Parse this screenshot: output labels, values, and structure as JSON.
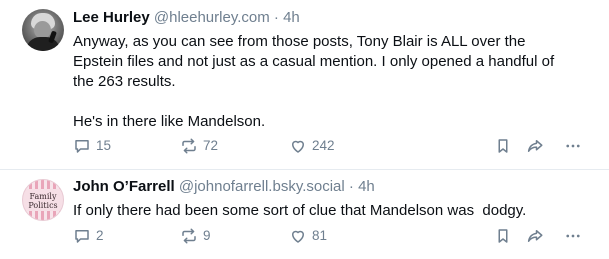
{
  "posts": [
    {
      "author": "Lee Hurley",
      "handle": "@hleehurley.com",
      "separator": "·",
      "time": "4h",
      "text_lines": [
        "Anyway, as you can see from those posts, Tony Blair is ALL over the",
        "Epstein files and not just as a casual mention. I only opened a handful of",
        "the 263 results.",
        "He's in there like Mandelson."
      ],
      "replies": "15",
      "reposts": "72",
      "likes": "242",
      "icons": [
        "reply-icon",
        "repost-icon",
        "like-icon",
        "bookmark-icon",
        "share-icon",
        "more-icon"
      ]
    },
    {
      "author": "John O’Farrell",
      "handle": "@johnofarrell.bsky.social",
      "separator": "·",
      "time": "4h",
      "text": "If only there had been some sort of clue that Mandelson was  dodgy.",
      "avatar_text": [
        "Family",
        "Politics"
      ],
      "replies": "2",
      "reposts": "9",
      "likes": "81",
      "icons": [
        "reply-icon",
        "repost-icon",
        "like-icon",
        "bookmark-icon",
        "share-icon",
        "more-icon"
      ]
    }
  ],
  "colors": {
    "text": "#0b0f14",
    "muted": "#6f7f8f",
    "divider": "#e6ebf0"
  }
}
